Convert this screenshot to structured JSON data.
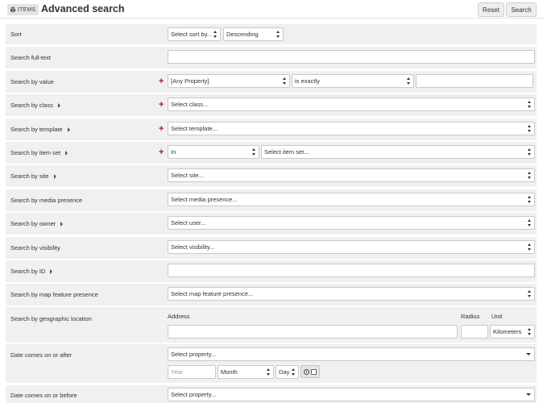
{
  "header": {
    "section_label": "ITEMS",
    "section_icon": "box-icon",
    "title": "Advanced search",
    "reset_label": "Reset",
    "search_label": "Search"
  },
  "sort": {
    "label": "Sort",
    "sort_by": "Select sort by...",
    "order": "Descending"
  },
  "fulltext": {
    "label": "Search full-text",
    "value": ""
  },
  "value": {
    "label": "Search by value",
    "property": "[Any Property]",
    "operator": "is exactly",
    "text": ""
  },
  "class": {
    "label": "Search by class",
    "select": "Select class..."
  },
  "template": {
    "label": "Search by template",
    "select": "Select template..."
  },
  "item_set": {
    "label": "Search by item set",
    "operator": "In",
    "select": "Select item set..."
  },
  "site": {
    "label": "Search by site",
    "select": "Select site..."
  },
  "media": {
    "label": "Search by media presence",
    "select": "Select media presence..."
  },
  "owner": {
    "label": "Search by owner",
    "select": "Select user..."
  },
  "visibility": {
    "label": "Search by visibility",
    "select": "Select visibility..."
  },
  "id": {
    "label": "Search by ID",
    "value": ""
  },
  "map_feature": {
    "label": "Search by map feature presence",
    "select": "Select map feature presence..."
  },
  "geo": {
    "label": "Search by geographic location",
    "address_label": "Address",
    "radius_label": "Radius",
    "unit_label": "Unit",
    "unit_value": "Kilometers"
  },
  "date_after": {
    "label": "Date comes on or after",
    "property": "Select property...",
    "year_placeholder": "Year",
    "month": "Month",
    "day": "Day"
  },
  "date_before": {
    "label": "Date comes on or before",
    "property": "Select property..."
  },
  "colors": {
    "row_bg": "#f0f0f0",
    "plus": "#8f1d1d",
    "button_bg": "#eeeeee"
  }
}
